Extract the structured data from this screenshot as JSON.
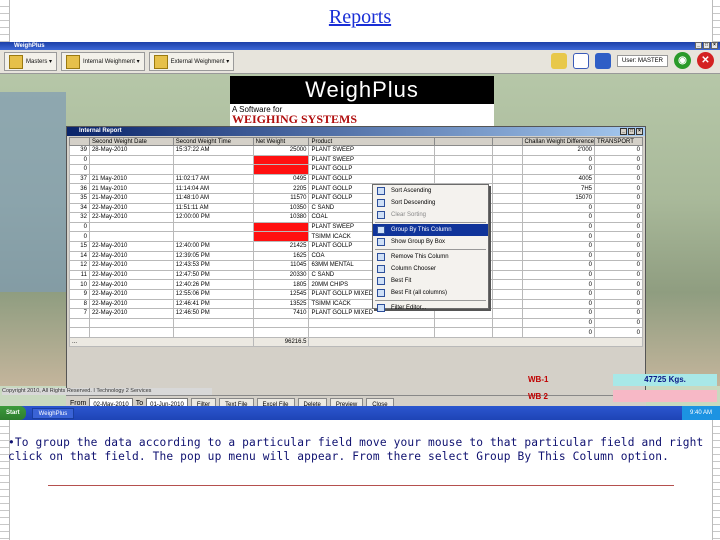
{
  "slide": {
    "title": "Reports",
    "instruction": "•To group the data according to a particular field move your mouse to that particular field and right click on that field. The pop up menu will appear. From there select Group By This Column option."
  },
  "app": {
    "window_title": "WeighPlus",
    "toolbar": {
      "masters_label": "Masters ▾",
      "internal_label": "Internal Weighment ▾",
      "external_label": "External Weighment ▾",
      "user_label": "User: MASTER"
    },
    "logo": {
      "wordmark": "WeighPlus",
      "line1": "A Software for",
      "line2": "WEIGHING SYSTEMS"
    }
  },
  "report": {
    "title": "Internal Report",
    "columns": [
      "",
      "Second Weight Date",
      "Second Weight Time",
      "Net Weight",
      "Product",
      "",
      "",
      "Challan Weight Difference",
      "TRANSPORT"
    ],
    "rows": [
      [
        "39",
        "28-May-2010",
        "15:37:22 AM",
        "25000",
        "PLANT SWEEP",
        "",
        "",
        "2'000",
        "0"
      ],
      [
        "0",
        "",
        "",
        "",
        "PLANT SWEEP",
        "",
        "",
        "0",
        "0"
      ],
      [
        "0",
        "",
        "",
        "",
        "PLANT GOLLP",
        "",
        "",
        "0",
        "0"
      ],
      [
        "37",
        "21 May-2010",
        "11:02:17 AM",
        "0495",
        "PLANT GOLLP",
        "",
        "",
        "4005",
        "0"
      ],
      [
        "36",
        "21 May-2010",
        "11:14:04 AM",
        "2205",
        "PLANT GOLLP",
        "",
        "",
        "7H5",
        "0"
      ],
      [
        "35",
        "21-May-2010",
        "11:48:10 AM",
        "11570",
        "PLANT GOLLP",
        "",
        "",
        "15070",
        "0"
      ],
      [
        "34",
        "22-May-2010",
        "11:51:11 AM",
        "10350",
        "C SAND",
        "",
        "",
        "0",
        "0"
      ],
      [
        "32",
        "22-May-2010",
        "12:00:00 PM",
        "10380",
        "COAL",
        "",
        "",
        "0",
        "0"
      ],
      [
        "0",
        "",
        "",
        "",
        "PLANT SWEEP",
        "",
        "",
        "0",
        "0"
      ],
      [
        "0",
        "",
        "",
        "",
        "TSIMM ICACK",
        "",
        "",
        "0",
        "0"
      ],
      [
        "15",
        "22-May-2010",
        "12:40:00 PM",
        "21425",
        "PLANT GOLLP",
        "",
        "",
        "0",
        "0"
      ],
      [
        "14",
        "22-May-2010",
        "12:39:05 PM",
        "1625",
        "COA",
        "",
        "",
        "0",
        "0"
      ],
      [
        "12",
        "22-May-2010",
        "12:43:53 PM",
        "11045",
        "63MM MENTAL",
        "",
        "",
        "0",
        "0"
      ],
      [
        "11",
        "22-May-2010",
        "12:47:50 PM",
        "20330",
        "C SAND",
        "",
        "",
        "0",
        "0"
      ],
      [
        "10",
        "22-May-2010",
        "12:40:26 PM",
        "1805",
        "20MM CHIPS",
        "",
        "",
        "0",
        "0"
      ],
      [
        "9",
        "22-May-2010",
        "12:55:06 PM",
        "12545",
        "PLANT GOLLP MIXED",
        "",
        "",
        "0",
        "0"
      ],
      [
        "8",
        "22-May-2010",
        "12:46:41 PM",
        "13525",
        "TSIMM ICACK",
        "",
        "",
        "0",
        "0"
      ],
      [
        "7",
        "22-May-2010",
        "12:46:50 PM",
        "7410",
        "PLANT GOLLP MIXED",
        "",
        "",
        "0",
        "0"
      ],
      [
        "",
        "",
        "",
        "",
        "",
        "",
        "",
        "0",
        "0"
      ],
      [
        "",
        "",
        "",
        "",
        "",
        "",
        "",
        "0",
        "0"
      ]
    ],
    "total": "96216.5",
    "red_rows": [
      1,
      2,
      8,
      9
    ],
    "context_menu": [
      {
        "label": "Sort Ascending",
        "disabled": false,
        "selected": false
      },
      {
        "label": "Sort Descending",
        "disabled": false,
        "selected": false
      },
      {
        "label": "Clear Sorting",
        "disabled": true,
        "selected": false
      },
      {
        "label": "Group By This Column",
        "disabled": false,
        "selected": true
      },
      {
        "label": "Show Group By Box",
        "disabled": false,
        "selected": false
      },
      {
        "label": "Remove This Column",
        "disabled": false,
        "selected": false
      },
      {
        "label": "Column Chooser",
        "disabled": false,
        "selected": false
      },
      {
        "label": "Best Fit",
        "disabled": false,
        "selected": false
      },
      {
        "label": "Best Fit (all columns)",
        "disabled": false,
        "selected": false
      },
      {
        "label": "Filter Editor...",
        "disabled": false,
        "selected": false
      }
    ],
    "footer": {
      "from_label": "From",
      "from_date": "02-May-2010",
      "to_label": "To",
      "to_date": "01-Jun-2010",
      "filter": "Filter",
      "text_file": "Text File",
      "excel_file": "Excel File",
      "delete": "Delete",
      "preview": "Preview",
      "close": "Close"
    }
  },
  "weighbridge": {
    "wb1_label": "WB-1",
    "wb1_value": "47725 Kgs.",
    "wb2_label": "WB 2",
    "wb2_value": ""
  },
  "copyright": "Copyright 2010, All Rights Reserved. I Technology 2 Services",
  "taskbar": {
    "start": "Start",
    "task": "WeighPlus",
    "clock": "9:40 AM"
  },
  "colors": {
    "title_link": "#1a2fd6",
    "instruction": "#0f1170",
    "highlight": "#10349a",
    "red_cell": "#ff1010",
    "wb1_bg": "#a8e8e8",
    "wb2_bg": "#f7b8c6"
  }
}
